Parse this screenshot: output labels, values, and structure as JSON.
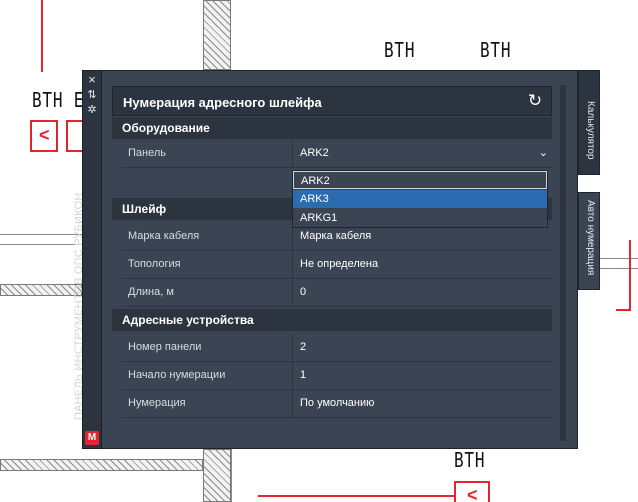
{
  "cad": {
    "labels": [
      "ВТН",
      "ВТН",
      "ВТН Е",
      "ВТН"
    ],
    "symbol": "<"
  },
  "strip": {
    "title": "ПАНЕЛЬ ИНСТРУМЕНТОВ ОПС РУБИКОН",
    "close_glyph": "×",
    "pin_glyph": "⇅",
    "settings_glyph": "✲",
    "logo_glyph": "M"
  },
  "panel": {
    "title": "Нумерация адресного шлейфа",
    "refresh_glyph": "↻"
  },
  "sections": {
    "equipment": "Оборудование",
    "loop": "Шлейф",
    "devices": "Адресные устройства"
  },
  "equipment": {
    "panel_label": "Панель",
    "panel_value": "ARK2",
    "chevron": "⌄"
  },
  "dropdown": {
    "options": [
      "ARK2",
      "ARK3",
      "ARKG1"
    ],
    "selected": "ARK2",
    "hovered": "ARK3"
  },
  "loop": {
    "cable_label": "Марка кабеля",
    "cable_value": "Марка кабеля",
    "topology_label": "Топология",
    "topology_value": "Не определена",
    "length_label": "Длина, м",
    "length_value": "0"
  },
  "devices": {
    "panel_no_label": "Номер панели",
    "panel_no_value": "2",
    "start_label": "Начало нумерации",
    "start_value": "1",
    "numbering_label": "Нумерация",
    "numbering_value": "По умолчанию"
  },
  "tabs": {
    "calculator": "Калькулятор",
    "auto_numbering": "Авто нумерация"
  },
  "colors": {
    "panel_bg": "#3b4453",
    "header_bg": "#2c3440",
    "accent_red": "#e4242f",
    "highlight_blue": "#2b6cb0"
  }
}
